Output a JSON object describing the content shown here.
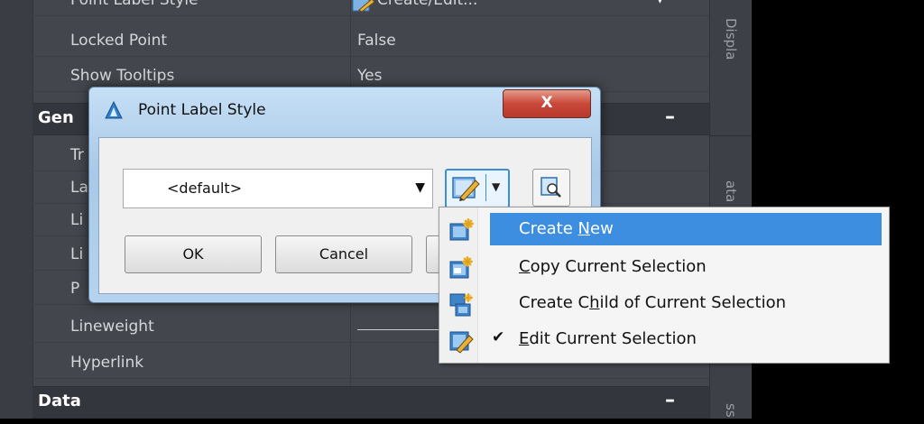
{
  "palette": {
    "rows": [
      {
        "label": "Point Label Style",
        "value": "Create/Edit..."
      },
      {
        "label": "Locked Point",
        "value": "False"
      },
      {
        "label": "Show Tooltips",
        "value": "Yes"
      },
      {
        "label": "Lineweight",
        "value": ""
      },
      {
        "label": "Hyperlink",
        "value": ""
      }
    ],
    "partial_labels": [
      "Tr",
      "La",
      "Li",
      "Li",
      "P"
    ],
    "sections": [
      {
        "title": "Gen",
        "collapse": "–"
      },
      {
        "title": "Data",
        "collapse": "–"
      }
    ],
    "side_tabs": [
      "Displa",
      "ata",
      "ss"
    ]
  },
  "dialog": {
    "title": "Point Label Style",
    "close_label": "X",
    "style_value": "<default>",
    "ok_label": "OK",
    "cancel_label": "Cancel"
  },
  "context_menu": {
    "items": [
      {
        "pre": "Create ",
        "u": "N",
        "post": "ew",
        "highlighted": true,
        "checked": false,
        "icon": "create-new-icon"
      },
      {
        "pre": "",
        "u": "C",
        "post": "opy Current Selection",
        "highlighted": false,
        "checked": false,
        "icon": "copy-selection-icon"
      },
      {
        "pre": "Create C",
        "u": "h",
        "post": "ild of Current Selection",
        "highlighted": false,
        "checked": false,
        "icon": "create-child-icon"
      },
      {
        "pre": "",
        "u": "E",
        "post": "dit Current Selection",
        "highlighted": false,
        "checked": true,
        "icon": "edit-selection-icon"
      }
    ],
    "check_mark": "✔"
  },
  "colors": {
    "palette_bg": "#43474d",
    "menu_highlight": "#3d8ee0",
    "dialog_frame": "#b6d3ee",
    "close_red": "#c9483a"
  }
}
